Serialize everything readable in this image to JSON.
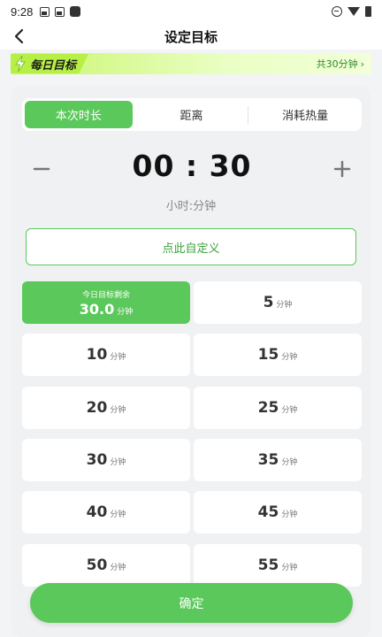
{
  "status_bar": {
    "time": "9:28"
  },
  "header": {
    "title": "设定目标",
    "back_icon": "back-arrow-icon"
  },
  "banner": {
    "title": "每日目标",
    "total": "共30分钟",
    "chevron": "›"
  },
  "tabs": [
    {
      "label": "本次时长",
      "active": true
    },
    {
      "label": "距离",
      "active": false
    },
    {
      "label": "消耗热量",
      "active": false
    }
  ],
  "timer": {
    "value": "00 : 30",
    "unit_label": "小时:分钟"
  },
  "custom_button": {
    "label": "点此自定义"
  },
  "daily_remaining": {
    "label": "今日目标剩余",
    "value": "30.0",
    "unit": "分钟"
  },
  "options": [
    {
      "value": "5",
      "unit": "分钟"
    },
    {
      "value": "10",
      "unit": "分钟"
    },
    {
      "value": "15",
      "unit": "分钟"
    },
    {
      "value": "20",
      "unit": "分钟"
    },
    {
      "value": "25",
      "unit": "分钟"
    },
    {
      "value": "30",
      "unit": "分钟"
    },
    {
      "value": "35",
      "unit": "分钟"
    },
    {
      "value": "40",
      "unit": "分钟"
    },
    {
      "value": "45",
      "unit": "分钟"
    },
    {
      "value": "50",
      "unit": "分钟"
    },
    {
      "value": "55",
      "unit": "分钟"
    }
  ],
  "confirm_button": {
    "label": "确定"
  },
  "colors": {
    "accent": "#5bc85b",
    "banner": "#c8f56a",
    "background": "#f3f4f6"
  }
}
